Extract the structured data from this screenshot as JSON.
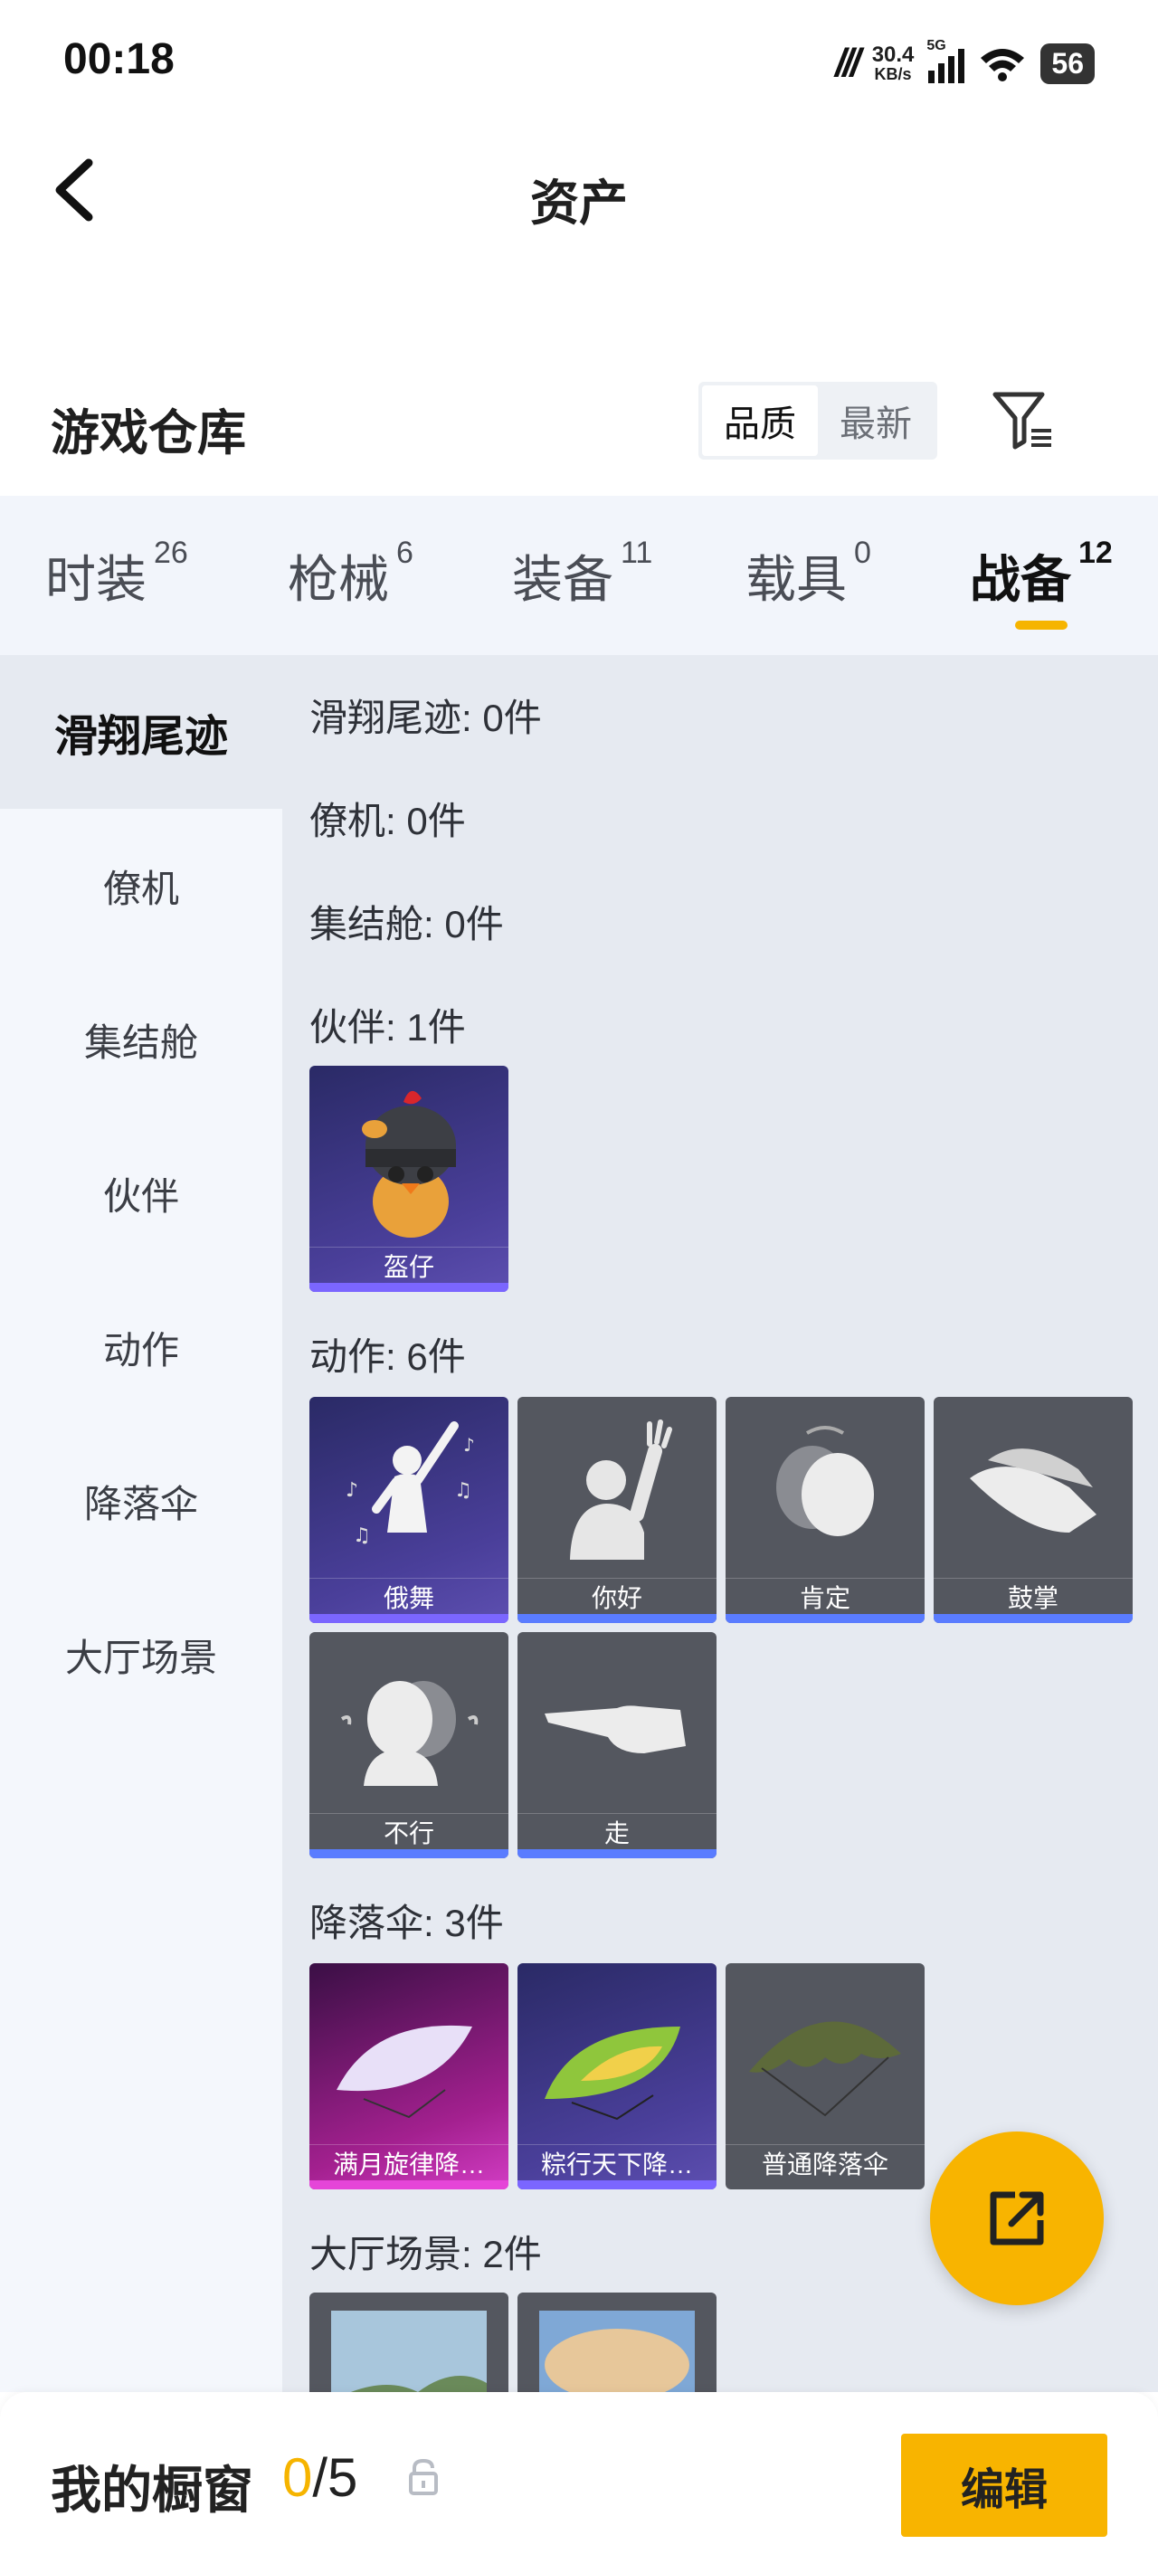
{
  "status": {
    "time": "00:18",
    "carrier_logo": "m",
    "speed_value": "30.4",
    "speed_unit": "KB/s",
    "network": "5G",
    "battery": "56"
  },
  "header": {
    "title": "资产",
    "back_icon": "back-arrow-icon"
  },
  "warehouse": {
    "title": "游戏仓库",
    "sort": [
      {
        "label": "品质",
        "selected": true
      },
      {
        "label": "最新",
        "selected": false
      }
    ],
    "filter_icon": "filter-icon"
  },
  "tabs": [
    {
      "label": "时装",
      "count": "26"
    },
    {
      "label": "枪械",
      "count": "6"
    },
    {
      "label": "装备",
      "count": "11"
    },
    {
      "label": "载具",
      "count": "0"
    },
    {
      "label": "战备",
      "count": "12",
      "active": true
    }
  ],
  "sidebar": [
    {
      "label": "滑翔尾迹",
      "active": true
    },
    {
      "label": "僚机"
    },
    {
      "label": "集结舱"
    },
    {
      "label": "伙伴"
    },
    {
      "label": "动作"
    },
    {
      "label": "降落伞"
    },
    {
      "label": "大厅场景"
    }
  ],
  "sections": [
    {
      "title": "滑翔尾迹: 0件",
      "items": []
    },
    {
      "title": "僚机: 0件",
      "items": []
    },
    {
      "title": "集结舱: 0件",
      "items": []
    },
    {
      "title": "伙伴: 1件",
      "items": [
        {
          "name": "盔仔",
          "rarity_color": "#7b66ff",
          "icon": "helmet-chick-icon"
        }
      ]
    },
    {
      "title": "动作: 6件",
      "items": [
        {
          "name": "俄舞",
          "rarity_color": "#7b66ff",
          "icon": "dance-icon"
        },
        {
          "name": "你好",
          "rarity_color": "#5a7cff",
          "icon": "wave-hand-icon"
        },
        {
          "name": "肯定",
          "rarity_color": "#5a7cff",
          "icon": "nod-icon"
        },
        {
          "name": "鼓掌",
          "rarity_color": "#5a7cff",
          "icon": "clap-icon"
        },
        {
          "name": "不行",
          "rarity_color": "#5a7cff",
          "icon": "shake-head-icon"
        },
        {
          "name": "走",
          "rarity_color": "#5a7cff",
          "icon": "point-hand-icon"
        }
      ]
    },
    {
      "title": "降落伞: 3件",
      "items": [
        {
          "name": "满月旋律降…",
          "rarity_color": "#e545d8",
          "icon": "parachute-icon"
        },
        {
          "name": "粽行天下降…",
          "rarity_color": "#7b66ff",
          "icon": "parachute-icon"
        },
        {
          "name": "普通降落伞",
          "rarity_color": "",
          "icon": "parachute-icon"
        }
      ]
    },
    {
      "title": "大厅场景: 2件",
      "items": [
        {
          "name": "",
          "icon": "landscape-icon"
        },
        {
          "name": "",
          "icon": "landscape-icon"
        }
      ]
    }
  ],
  "fab": {
    "icon": "share-external-icon"
  },
  "showcase": {
    "title": "我的橱窗",
    "current": "0",
    "separator_total": "/5",
    "lock_icon": "unlock-icon",
    "edit_label": "编辑"
  },
  "colors": {
    "accent": "#f8b400",
    "tab_bg": "#f2f5fb",
    "content_bg": "#e6eaf1"
  }
}
